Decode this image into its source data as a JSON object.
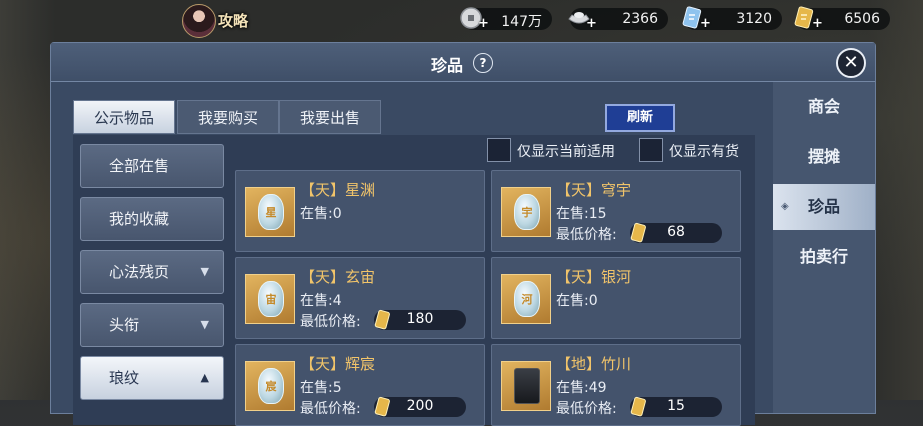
{
  "topbar": {
    "guide_label": "攻略",
    "resources": [
      {
        "icon": "silver-coin-icon",
        "value": "147万"
      },
      {
        "icon": "silver-ingot-icon",
        "value": "2366"
      },
      {
        "icon": "blue-token-icon",
        "value": "3120"
      },
      {
        "icon": "gold-token-icon",
        "value": "6506"
      }
    ]
  },
  "panel": {
    "title": "珍品",
    "help": "?"
  },
  "tabs": [
    "公示物品",
    "我要购买",
    "我要出售"
  ],
  "refresh_label": "刷新",
  "filters": [
    "仅显示当前适用",
    "仅显示有货"
  ],
  "categories": [
    {
      "label": "全部在售",
      "arrow": ""
    },
    {
      "label": "我的收藏",
      "arrow": ""
    },
    {
      "label": "心法残页",
      "arrow": "▼"
    },
    {
      "label": "头衔",
      "arrow": "▼"
    },
    {
      "label": "琅纹",
      "arrow": "▲"
    }
  ],
  "right_nav": [
    "商会",
    "摆摊",
    "珍品",
    "拍卖行"
  ],
  "items": [
    {
      "name": "【天】星渊",
      "stock": "在售:0",
      "price_label": "",
      "price": "",
      "rune": "星"
    },
    {
      "name": "【天】穹宇",
      "stock": "在售:15",
      "price_label": "最低价格:",
      "price": "68",
      "rune": "宇"
    },
    {
      "name": "【天】玄宙",
      "stock": "在售:4",
      "price_label": "最低价格:",
      "price": "180",
      "rune": "宙"
    },
    {
      "name": "【天】银河",
      "stock": "在售:0",
      "price_label": "",
      "price": "",
      "rune": "河"
    },
    {
      "name": "【天】辉宸",
      "stock": "在售:5",
      "price_label": "最低价格:",
      "price": "200",
      "rune": "宸"
    },
    {
      "name": "【地】竹川",
      "stock": "在售:49",
      "price_label": "最低价格:",
      "price": "15",
      "rune": ""
    }
  ]
}
